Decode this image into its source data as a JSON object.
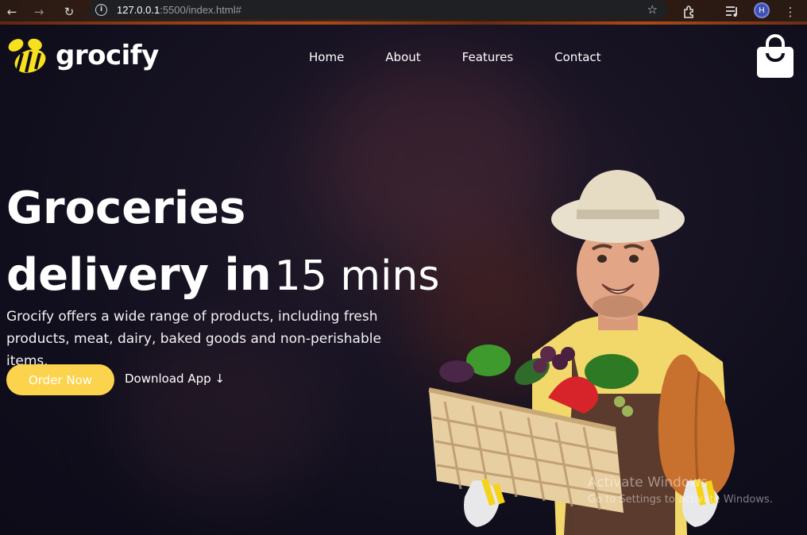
{
  "browser": {
    "url_host": "127.0.0.1",
    "url_path": ":5500/index.html#",
    "profile_initial": "H"
  },
  "brand": {
    "name": "grocify",
    "accent": "#fcd34d",
    "logo_color": "#f7e11f"
  },
  "nav": {
    "items": [
      {
        "label": "Home"
      },
      {
        "label": "About"
      },
      {
        "label": "Features"
      },
      {
        "label": "Contact"
      }
    ]
  },
  "hero": {
    "title_line1": "Groceries",
    "title_line2_bold": "delivery in",
    "title_line2_light": "15 mins",
    "description": "Grocify offers a wide range of products, including fresh products, meat, dairy, baked goods and non-perishable items.",
    "order_button": "Order Now",
    "download_button": "Download App ↓"
  },
  "watermark": {
    "line1": "Activate Windows",
    "line2": "Go to Settings to activate Windows."
  },
  "icons": [
    "back-arrow-icon",
    "forward-arrow-icon",
    "reload-icon",
    "info-icon",
    "star-icon",
    "extensions-icon",
    "media-icon",
    "menu-dots-icon",
    "logo-bee-icon",
    "shopping-bag-icon"
  ]
}
